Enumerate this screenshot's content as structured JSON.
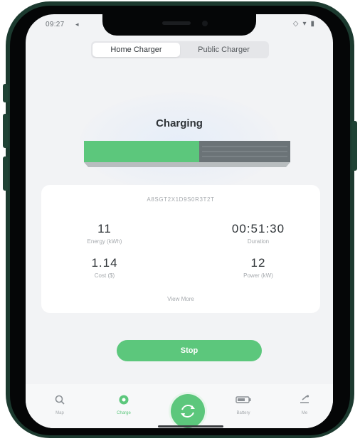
{
  "status_bar": {
    "time": "09:27",
    "location_glyph": "◂",
    "right_icons": [
      "◇",
      "▾",
      "▮"
    ]
  },
  "segmented": {
    "tabs": [
      {
        "label": "Home Charger",
        "active": true
      },
      {
        "label": "Public Charger",
        "active": false
      }
    ]
  },
  "charging": {
    "title": "Charging",
    "charge_level": 0.56,
    "colors": {
      "filled": "#5cc77c",
      "empty": "#6b7377"
    }
  },
  "card": {
    "charger_id": "A8SGT2X1D9S0R3T2T",
    "stats": [
      {
        "value": "11",
        "label": "Energy (kWh)"
      },
      {
        "value": "00:51:30",
        "label": "Duration"
      },
      {
        "value": "1.14",
        "label": "Cost ($)"
      },
      {
        "value": "12",
        "label": "Power (kW)"
      }
    ],
    "view_more": "View More"
  },
  "actions": {
    "stop_label": "Stop"
  },
  "tabbar": {
    "tabs": [
      {
        "label": "Map",
        "icon": "search-icon"
      },
      {
        "label": "Charge",
        "icon": "charge-icon",
        "active": true
      },
      {
        "label": "",
        "icon": "center-charge-icon"
      },
      {
        "label": "Battery",
        "icon": "battery-icon"
      },
      {
        "label": "Me",
        "icon": "profile-icon"
      }
    ]
  },
  "theme": {
    "accent": "#5cc77c",
    "frame": "#1c3a2f"
  }
}
